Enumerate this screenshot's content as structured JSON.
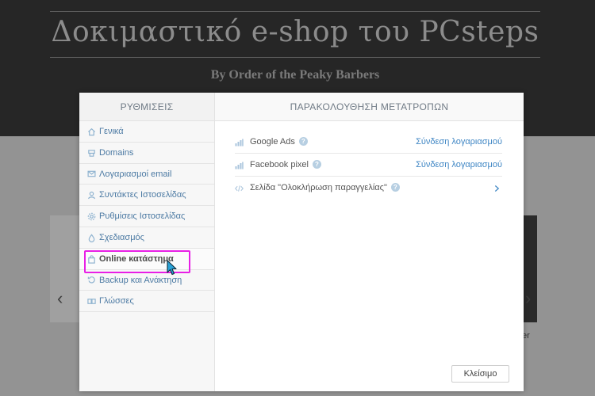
{
  "site": {
    "title": "Δοκιμαστικό e-shop του PCsteps",
    "subtitle": "By Order of the Peaky Barbers",
    "right_card_text": "er"
  },
  "sidebar": {
    "header": "ΡΥΘΜΙΣΕΙΣ",
    "items": [
      {
        "label": "Γενικά",
        "icon": "home-icon"
      },
      {
        "label": "Domains",
        "icon": "domain-icon"
      },
      {
        "label": "Λογαριασμοί email",
        "icon": "mail-icon"
      },
      {
        "label": "Συντάκτες Ιστοσελίδας",
        "icon": "user-icon"
      },
      {
        "label": "Ρυθμίσεις Ιστοσελίδας",
        "icon": "gear-icon"
      },
      {
        "label": "Σχεδιασμός",
        "icon": "paint-drop-icon"
      },
      {
        "label": "Online κατάστημα",
        "icon": "shopping-bag-icon",
        "active": true
      },
      {
        "label": "Backup και Ανάκτηση",
        "icon": "backup-icon"
      },
      {
        "label": "Γλώσσες",
        "icon": "language-icon"
      }
    ]
  },
  "main": {
    "header": "ΠΑΡΑΚΟΛΟΥΘΗΣΗ ΜΕΤΑΤΡΟΠΩΝ",
    "rows": [
      {
        "label": "Google Ads",
        "action": "Σύνδεση λογαριασμού",
        "icon": "bar-chart-icon"
      },
      {
        "label": "Facebook pixel",
        "action": "Σύνδεση λογαριασμού",
        "icon": "bar-chart-icon"
      },
      {
        "label": "Σελίδα \"Ολοκλήρωση παραγγελίας\"",
        "action": "",
        "icon": "code-icon"
      }
    ],
    "close_label": "Κλείσιμο"
  },
  "colors": {
    "accent": "#3f86c4",
    "highlight": "#e81fe6"
  }
}
